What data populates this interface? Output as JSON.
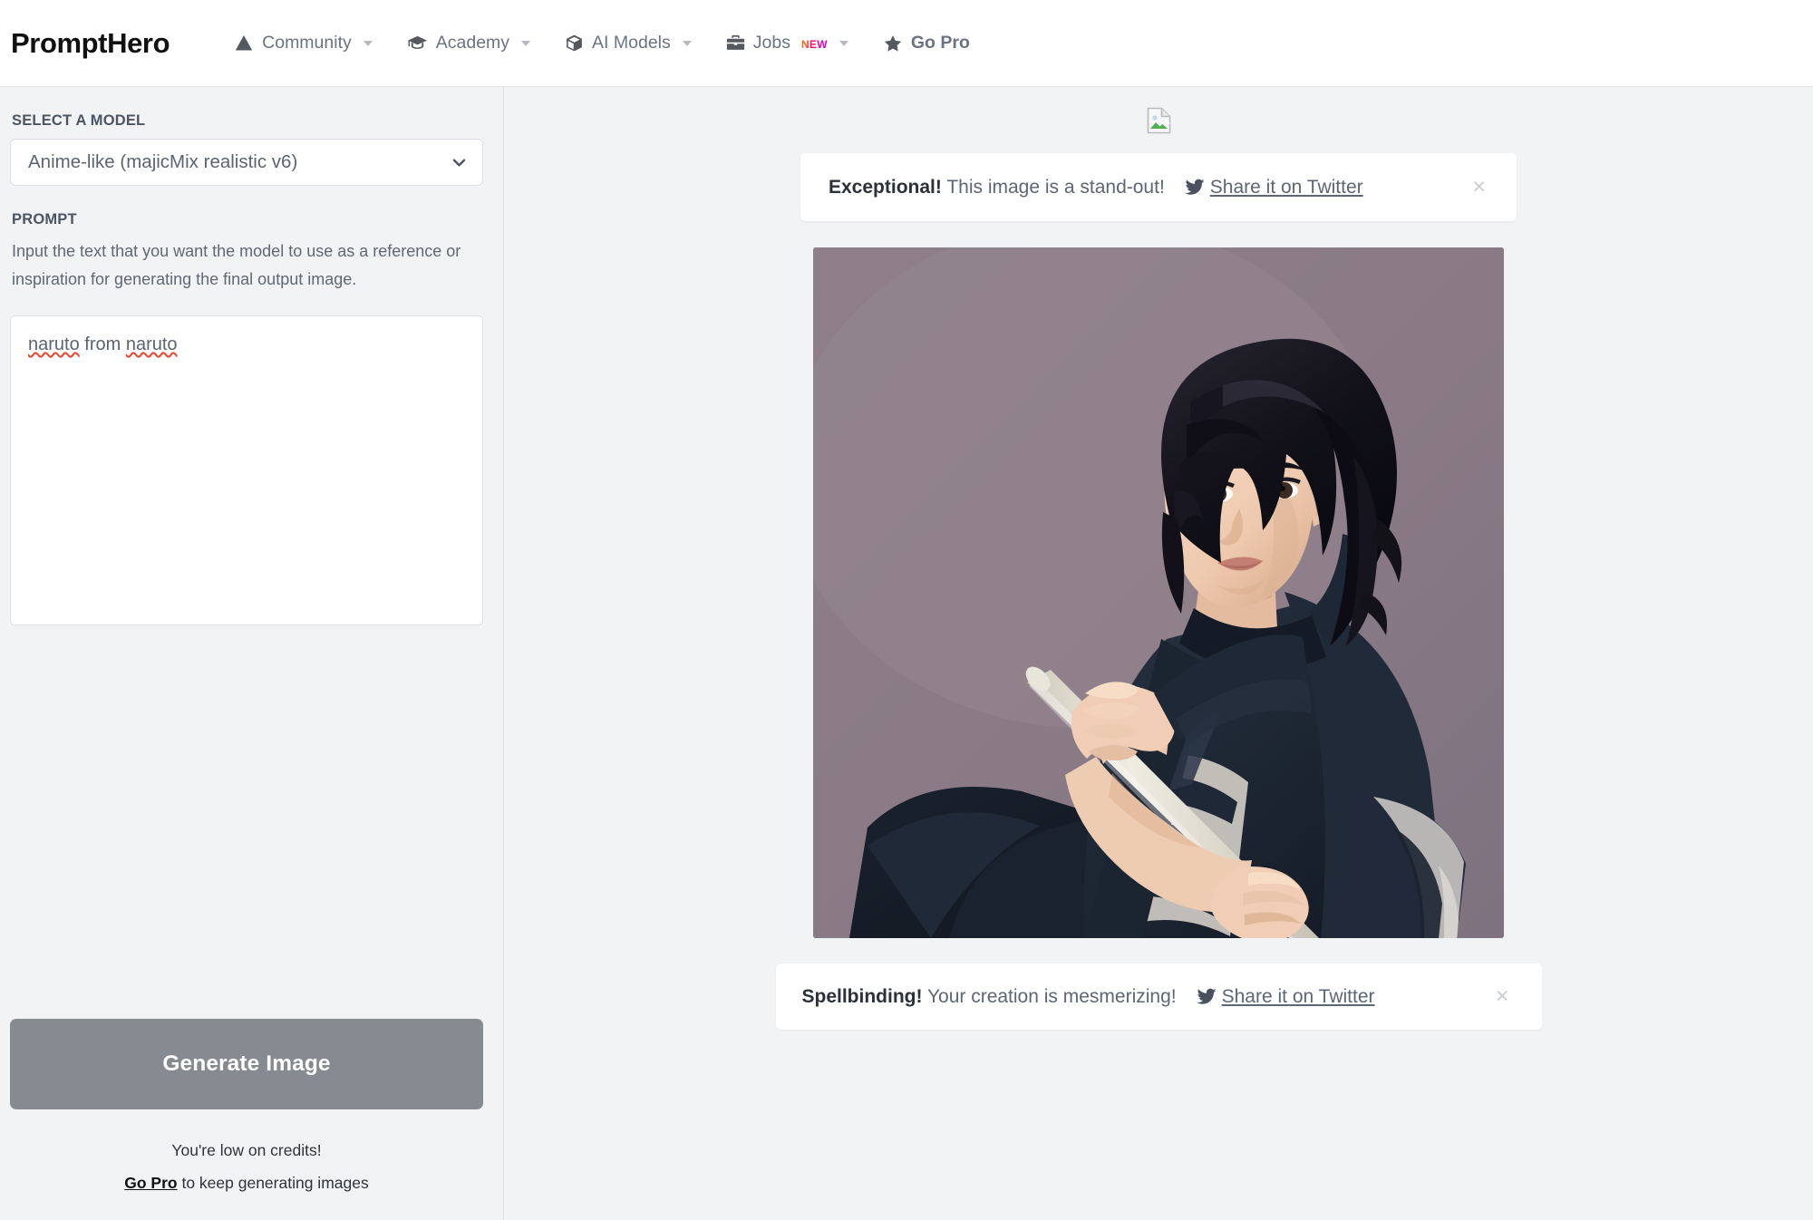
{
  "header": {
    "brand": "PromptHero",
    "nav": [
      {
        "label": "Community",
        "icon": "tent-icon",
        "has_caret": true,
        "badge": null
      },
      {
        "label": "Academy",
        "icon": "graduation-cap-icon",
        "has_caret": true,
        "badge": null
      },
      {
        "label": "AI Models",
        "icon": "cube-icon",
        "has_caret": true,
        "badge": null
      },
      {
        "label": "Jobs",
        "icon": "briefcase-icon",
        "has_caret": true,
        "badge": "NEW"
      },
      {
        "label": "Go Pro",
        "icon": "star-icon",
        "has_caret": false,
        "badge": null
      }
    ]
  },
  "sidebar": {
    "model_label": "SELECT A MODEL",
    "model_value": "Anime-like (majicMix realistic v6)",
    "prompt_label": "PROMPT",
    "prompt_help": "Input the text that you want the model to use as a reference or inspiration for generating the final output image.",
    "prompt_value": "naruto from naruto",
    "prompt_words": [
      "naruto",
      "from",
      "naruto"
    ],
    "prompt_misspelled": [
      "naruto"
    ],
    "generate_label": "Generate Image",
    "credits_line": "You're low on credits!",
    "credits_cta": "Go Pro",
    "credits_cta_tail": " to keep generating images"
  },
  "main": {
    "broken_image_icon": "broken-image-icon",
    "banner_top": {
      "headline": "Exceptional!",
      "message": " This image is a stand-out!",
      "share_label": "Share it on Twitter",
      "share_icon": "twitter-icon",
      "close_label": "×"
    },
    "banner_bottom": {
      "headline": "Spellbinding!",
      "message": " Your creation is mesmerizing!",
      "share_label": "Share it on Twitter",
      "share_icon": "twitter-icon",
      "close_label": "×"
    },
    "generated_image": {
      "alt": "Anime-style portrait of a dark-haired man in a navy kimono holding a wooden staff",
      "background_color": "#8a7b87",
      "garment_color": "#1d2633",
      "skin_color": "#f0cdb4",
      "hair_color": "#14131a",
      "staff_color": "#e6e3da"
    }
  },
  "colors": {
    "page_bg": "#f2f3f5",
    "panel_bg": "#ffffff",
    "border": "#dcdfe3",
    "text_muted": "#5f6874",
    "text_dark": "#2b3039",
    "button_disabled": "#868a91",
    "spellcheck_red": "#f0432c",
    "badge_gradient_start": "#ff7a00",
    "badge_gradient_end": "#c800ff"
  }
}
